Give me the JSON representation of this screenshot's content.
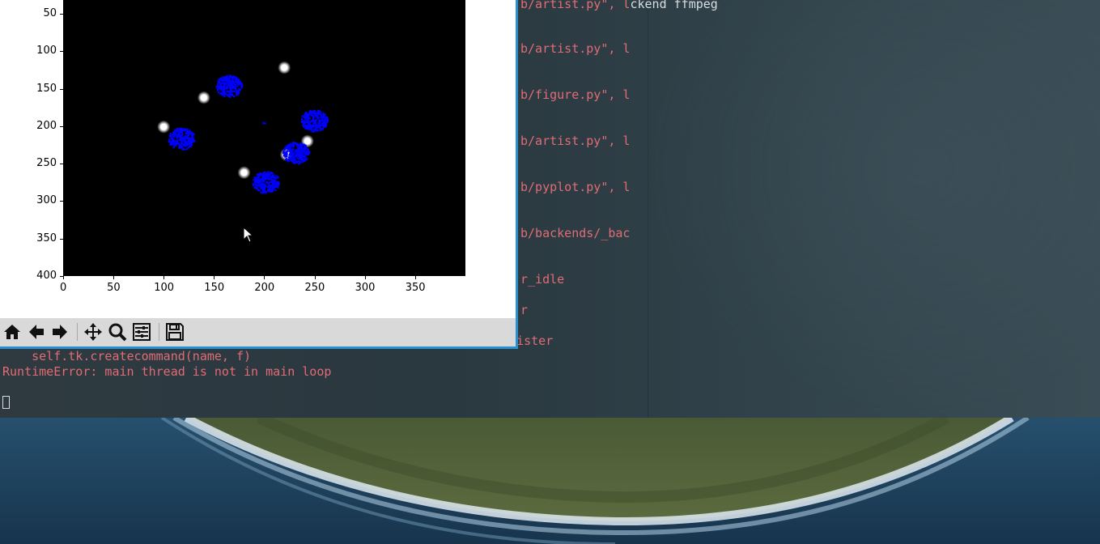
{
  "terminal": {
    "right_lines": [
      {
        "text": "b/artist.py\", l",
        "extra": "ckend ffmpeg"
      },
      {
        "text": "b/artist.py\", l"
      },
      {
        "text": "b/figure.py\", l"
      },
      {
        "text": "b/artist.py\", l"
      },
      {
        "text": "b/pyplot.py\", l"
      },
      {
        "text": "b/backends/_bac"
      },
      {
        "text": "r_idle"
      },
      {
        "text": "r"
      },
      {
        "text": "_egister"
      }
    ],
    "bottom_lines": [
      "    self.tk.createcommand(name, f)",
      "RuntimeError: main thread is not in main loop"
    ]
  },
  "plot": {
    "y_ticks": [
      "50",
      "100",
      "150",
      "200",
      "250",
      "300",
      "350",
      "400"
    ],
    "x_ticks": [
      "0",
      "50",
      "100",
      "150",
      "200",
      "250",
      "300",
      "350"
    ]
  },
  "chart_data": {
    "type": "scatter",
    "title": "",
    "xlabel": "",
    "ylabel": "",
    "xlim": [
      0,
      400
    ],
    "ylim": [
      400,
      0
    ],
    "background": "#000000",
    "series": [
      {
        "color": "#0000ff",
        "clusters": [
          {
            "x": 165,
            "y": 147
          },
          {
            "x": 118,
            "y": 217
          },
          {
            "x": 250,
            "y": 193
          },
          {
            "x": 232,
            "y": 236
          },
          {
            "x": 202,
            "y": 275
          },
          {
            "x": 200,
            "y": 196
          }
        ]
      },
      {
        "color": "#ffffff",
        "points": [
          {
            "x": 220,
            "y": 122
          },
          {
            "x": 140,
            "y": 162
          },
          {
            "x": 100,
            "y": 201
          },
          {
            "x": 180,
            "y": 262
          },
          {
            "x": 222,
            "y": 238
          },
          {
            "x": 243,
            "y": 220
          }
        ]
      }
    ]
  },
  "toolbar": {
    "buttons": [
      "home-icon",
      "back-arrow-icon",
      "forward-arrow-icon",
      "pan-icon",
      "zoom-icon",
      "configure-subplots-icon",
      "save-icon"
    ]
  },
  "colors": {
    "error_text": "#e06c75",
    "window_border": "#2a8fd0",
    "toolbar_bg": "#d9d9d9"
  }
}
